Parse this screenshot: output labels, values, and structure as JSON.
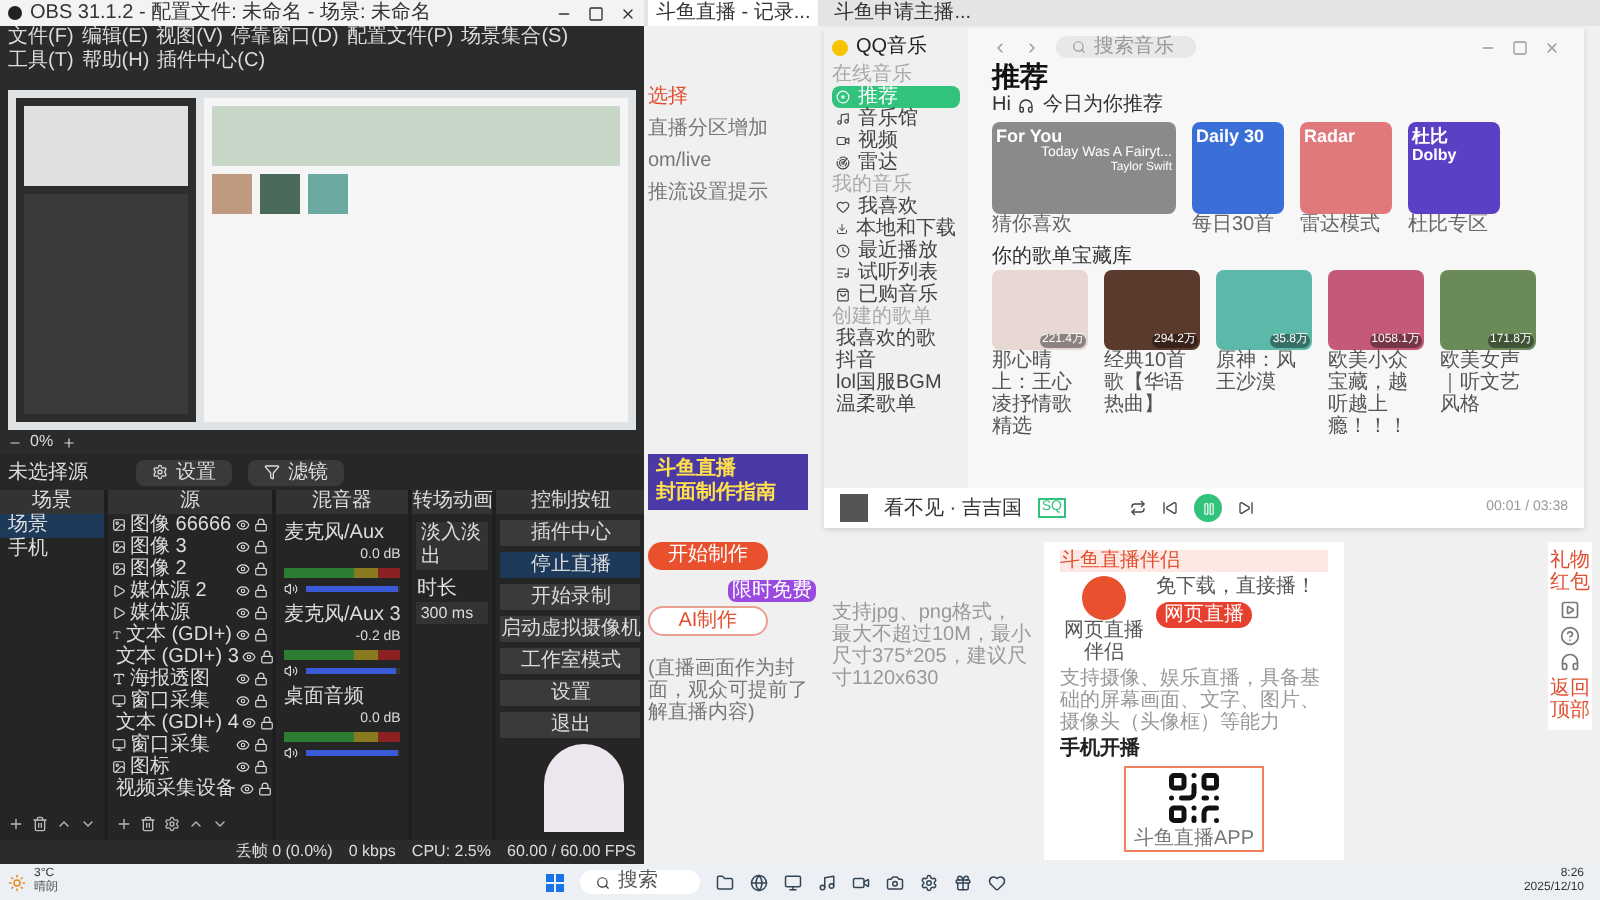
{
  "obs": {
    "title": "OBS 31.1.2 - 配置文件: 未命名 - 场景: 未命名",
    "menu": [
      "文件(F)",
      "编辑(E)",
      "视图(V)",
      "停靠窗口(D)",
      "配置文件(P)",
      "场景集合(S)",
      "工具(T)",
      "帮助(H)",
      "插件中心(C)"
    ],
    "zoom": "0%",
    "no_source": "未选择源",
    "source_buttons": [
      "设置",
      "滤镜"
    ],
    "docks": [
      "场景",
      "源",
      "混音器",
      "转场动画",
      "控制按钮"
    ],
    "scenes": [
      {
        "name": "场景",
        "selected": true
      },
      {
        "name": "手机",
        "selected": false
      }
    ],
    "sources": [
      {
        "name": "图像 66666",
        "kind": "image"
      },
      {
        "name": "图像 3",
        "kind": "image"
      },
      {
        "name": "图像 2",
        "kind": "image"
      },
      {
        "name": "媒体源 2",
        "kind": "media"
      },
      {
        "name": "媒体源",
        "kind": "media"
      },
      {
        "name": "文本 (GDI+)",
        "kind": "text"
      },
      {
        "name": "文本 (GDI+) 3",
        "kind": "text"
      },
      {
        "name": "海报透图",
        "kind": "text"
      },
      {
        "name": "窗口采集",
        "kind": "window"
      },
      {
        "name": "文本 (GDI+) 4",
        "kind": "text"
      },
      {
        "name": "窗口采集",
        "kind": "window"
      },
      {
        "name": "图标",
        "kind": "image"
      },
      {
        "name": "视频采集设备",
        "kind": "camera"
      }
    ],
    "mixer": [
      {
        "name": "麦克风/Aux",
        "reading": "0.0 dB",
        "level": 0.97
      },
      {
        "name": "麦克风/Aux 3",
        "reading": "-0.2 dB",
        "level": 0.96
      },
      {
        "name": "桌面音频",
        "reading": "0.0 dB",
        "level": 0.97
      }
    ],
    "transition": {
      "value": "淡入淡出",
      "duration_label": "时长",
      "duration": "300 ms"
    },
    "controls": [
      "插件中心",
      "停止直播",
      "开始录制",
      "启动虚拟摄像机",
      "工作室模式",
      "设置",
      "退出"
    ],
    "status": [
      "丢帧 0 (0.0%)",
      "0 kbps",
      "CPU: 2.5%",
      "60.00 / 60.00 FPS"
    ]
  },
  "browser": {
    "tabs": [
      {
        "title": "斗鱼直播 - 记录...",
        "selected": true
      },
      {
        "title": "斗鱼申请主播...",
        "selected": false
      }
    ],
    "left_texts": [
      "选择",
      "直播分区增加",
      "om/live",
      "推流设置提示"
    ],
    "banner": [
      "斗鱼直播",
      "封面制作指南"
    ],
    "make_button": "开始制作",
    "ai_button": "AI制作",
    "ai_badge": "限时免费",
    "hint": "支持jpg、png格式，最大不超过10M，最小尺寸375*205，建议尺寸1120x630",
    "note": "(直播画面作为封面，观众可提前了解直播内容)",
    "panel": {
      "header": "斗鱼直播伴侣",
      "slogan": "免下载，直接播！",
      "desc": "支持摄像、娱乐直播，具备基础的屏幕画面、文字、图片、摄像头（头像框）等能力",
      "button": "网页直播",
      "caption": "网页直播伴侣",
      "mobile_title": "手机开播",
      "qr_caption": "斗鱼直播APP"
    },
    "side_tools": [
      "礼物红包",
      "返回顶部"
    ]
  },
  "qqmusic": {
    "logo": "QQ音乐",
    "search": "搜索音乐",
    "nav": [
      {
        "section": "在线音乐",
        "items": [
          {
            "label": "推荐",
            "selected": true
          },
          {
            "label": "音乐馆",
            "selected": false
          },
          {
            "label": "视频",
            "selected": false
          },
          {
            "label": "雷达",
            "selected": false
          }
        ]
      },
      {
        "section": "我的音乐",
        "items": [
          {
            "label": "我喜欢",
            "selected": false
          },
          {
            "label": "本地和下载",
            "selected": false
          },
          {
            "label": "最近播放",
            "selected": false
          },
          {
            "label": "试听列表",
            "selected": false
          },
          {
            "label": "已购音乐",
            "selected": false
          }
        ]
      },
      {
        "section": "创建的歌单",
        "items": [
          {
            "label": "我喜欢的歌",
            "selected": false
          },
          {
            "label": "抖音",
            "selected": false
          },
          {
            "label": "lol国服BGM",
            "selected": false
          },
          {
            "label": "温柔歌单",
            "selected": false
          }
        ]
      }
    ],
    "title": "推荐",
    "greeting": "Hi",
    "subtitle": "今日为你推荐",
    "featured": [
      {
        "tag": "For You",
        "song": "Today Was A Fairyt...",
        "artist": "Taylor Swift",
        "caption": "猜你喜欢",
        "color": "#8a8a8a"
      },
      {
        "tag": "Daily 30",
        "caption": "每日30首",
        "color": "#3b6fd8"
      },
      {
        "tag": "Radar",
        "caption": "雷达模式",
        "color": "#e0787c"
      },
      {
        "tag": "杜比",
        "badge": "Dolby",
        "caption": "杜比专区",
        "color": "#5b3fc4"
      }
    ],
    "library_title": "你的歌单宝藏库",
    "playlists": [
      {
        "count": "221.4万",
        "caption": "那心晴上：王心凌抒情歌精选",
        "color": "#e8d8d4"
      },
      {
        "count": "294.2万",
        "caption": "经典10首歌【华语热曲】",
        "color": "#5a3a2c"
      },
      {
        "count": "35.8万",
        "caption": "原神：风王沙漠",
        "color": "#5cb8a8"
      },
      {
        "count": "1058.1万",
        "caption": "欧美小众宝藏，越听越上瘾！！！",
        "color": "#c45a78"
      },
      {
        "count": "171.8万",
        "caption": "欧美女声｜听文艺风格",
        "color": "#6a8a5a"
      }
    ],
    "player": {
      "track": "看不见 · 吉吉国",
      "quality": "SQ",
      "time": "00:01 / 03:38"
    }
  },
  "taskbar": {
    "temperature": "3°C",
    "weather": "晴朗",
    "search": "搜索",
    "time": "8:26",
    "date": "2025/12/10"
  }
}
